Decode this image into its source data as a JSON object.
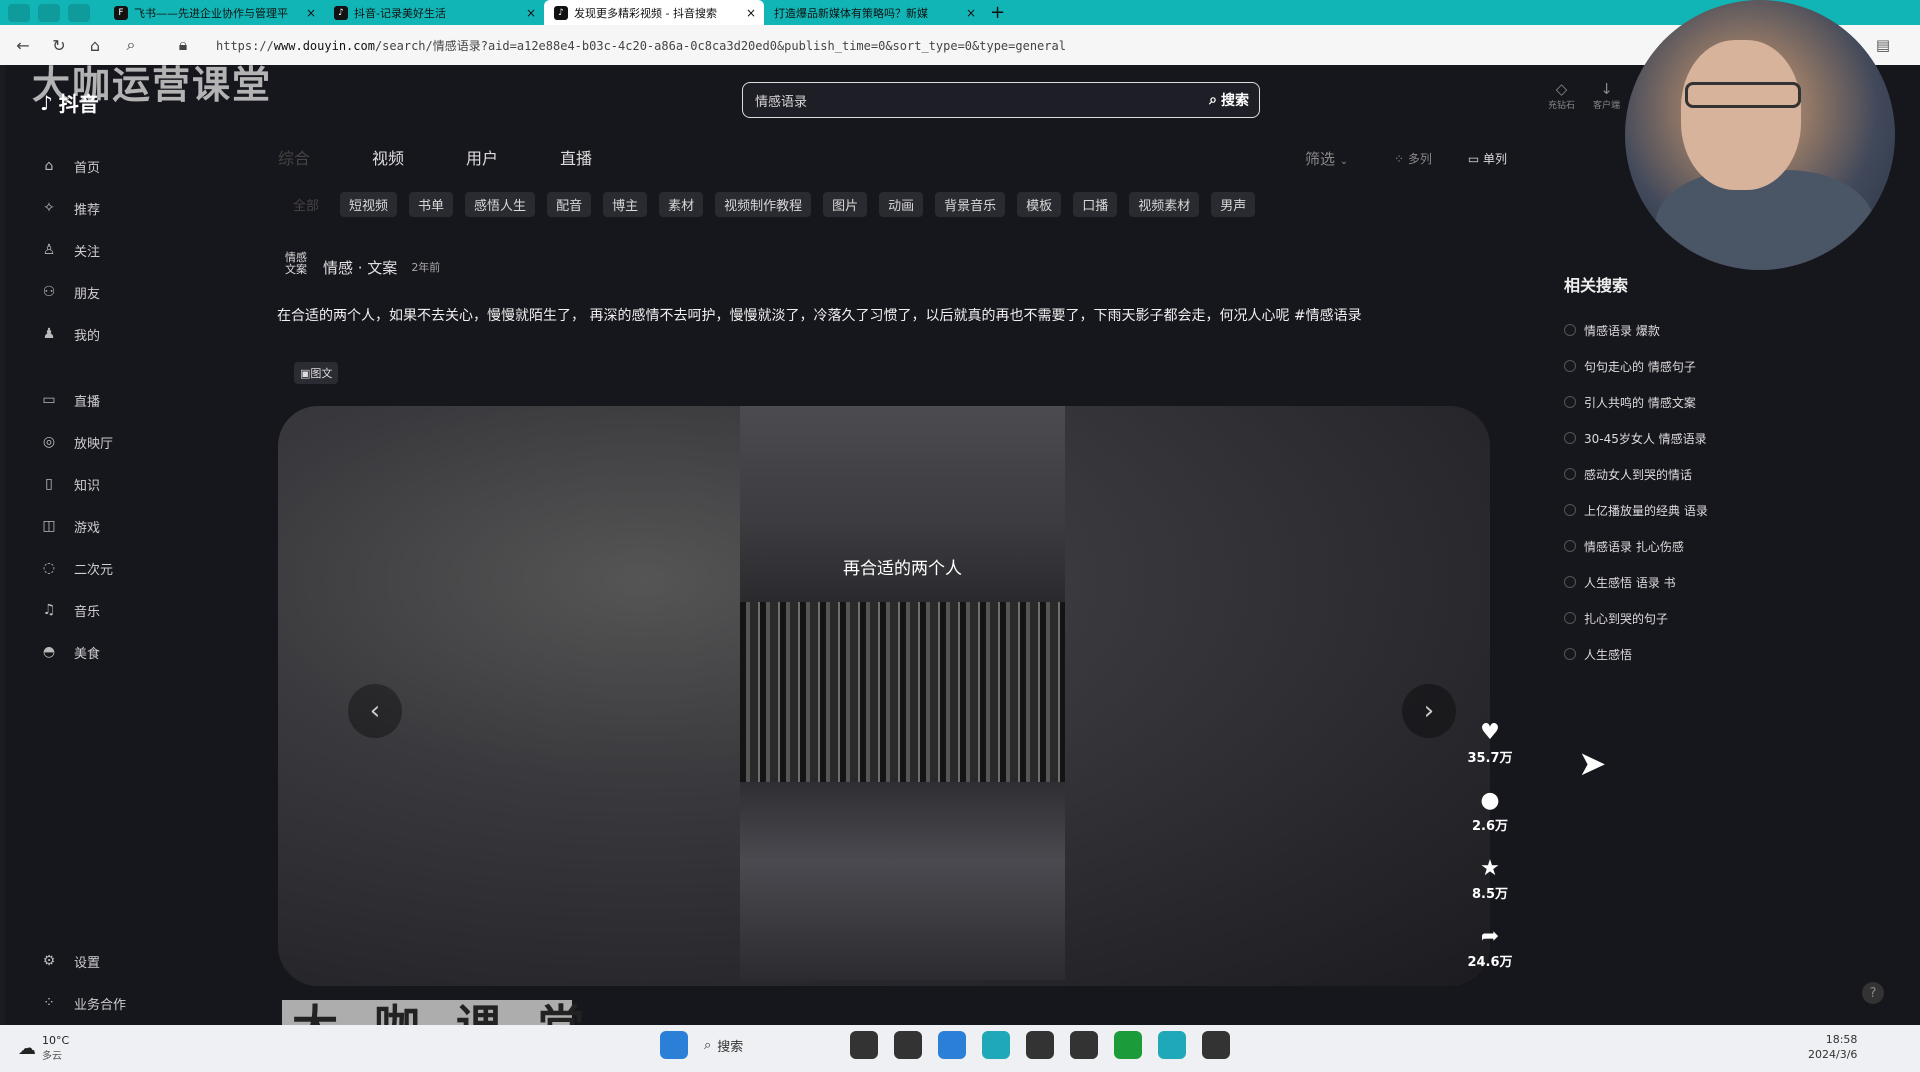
{
  "browser": {
    "tabs": [
      {
        "label": "飞书——先进企业协作与管理平",
        "close": "×"
      },
      {
        "label": "抖音-记录美好生活",
        "close": "×"
      },
      {
        "label": "发现更多精彩视频 - 抖音搜索",
        "close": "×",
        "active": true
      },
      {
        "label": "打造爆品新媒体有策略吗？新媒",
        "close": "×"
      }
    ],
    "new_tab": "+",
    "url_prefix": "https://",
    "url_domain": "www.douyin.com",
    "url_path": "/search/情感语录?aid=a12e88e4-b03c-4c20-a86a-0c8ca3d20ed0&publish_time=0&sort_type=0&type=general"
  },
  "watermark": {
    "top": "大咖运营课堂",
    "bottom": "大 咖 课 堂"
  },
  "logo": {
    "text": "抖音"
  },
  "search": {
    "value": "情感语录",
    "button": "搜索"
  },
  "top_icons": [
    {
      "label": "充钻石",
      "icon": "diamond-icon"
    },
    {
      "label": "客户端",
      "icon": "download-icon"
    }
  ],
  "sidebar": {
    "items": [
      {
        "label": "首页",
        "icon": "home-icon"
      },
      {
        "label": "推荐",
        "icon": "recommend-icon"
      },
      {
        "label": "关注",
        "icon": "follow-icon"
      },
      {
        "label": "朋友",
        "icon": "friends-icon"
      },
      {
        "label": "我的",
        "icon": "user-icon"
      },
      {
        "label": "直播",
        "icon": "live-icon"
      },
      {
        "label": "放映厅",
        "icon": "cinema-icon"
      },
      {
        "label": "知识",
        "icon": "knowledge-icon"
      },
      {
        "label": "游戏",
        "icon": "game-icon"
      },
      {
        "label": "二次元",
        "icon": "anime-icon"
      },
      {
        "label": "音乐",
        "icon": "music-icon"
      },
      {
        "label": "美食",
        "icon": "food-icon"
      }
    ],
    "bottom": [
      {
        "label": "设置",
        "icon": "settings-icon"
      },
      {
        "label": "业务合作",
        "icon": "business-icon"
      }
    ]
  },
  "main_tabs": [
    "综合",
    "视频",
    "用户",
    "直播"
  ],
  "filter_label": "筛选",
  "view_modes": [
    "多列",
    "单列"
  ],
  "chips": [
    "全部",
    "短视频",
    "书单",
    "感悟人生",
    "配音",
    "博主",
    "素材",
    "视频制作教程",
    "图片",
    "动画",
    "背景音乐",
    "模板",
    "口播",
    "视频素材",
    "男声"
  ],
  "post": {
    "avatar_text": "情感文案",
    "author": "情感 · 文案",
    "time": "2年前",
    "description": "在合适的两个人，如果不去关心，慢慢就陌生了， 再深的感情不去呵护，慢慢就淡了，冷落久了习惯了，以后就真的再也不需要了，下雨天影子都会走，何况人心呢 #情感语录",
    "badge": "图文",
    "caption": "再合适的两个人",
    "likes": "35.7万",
    "comments": "2.6万",
    "favorites": "8.5万",
    "shares": "24.6万"
  },
  "related": {
    "title": "相关搜索",
    "items": [
      "情感语录 爆款",
      "句句走心的 情感句子",
      "引人共鸣的 情感文案",
      "30-45岁女人 情感语录",
      "感动女人到哭的情话",
      "上亿播放量的经典 语录",
      "情感语录 扎心伤感",
      "人生感悟 语录 书",
      "扎心到哭的句子",
      "人生感悟"
    ]
  },
  "taskbar": {
    "temp": "10°C",
    "weather": "多云",
    "search": "搜索",
    "time": "18:58",
    "date": "2024/3/6"
  }
}
